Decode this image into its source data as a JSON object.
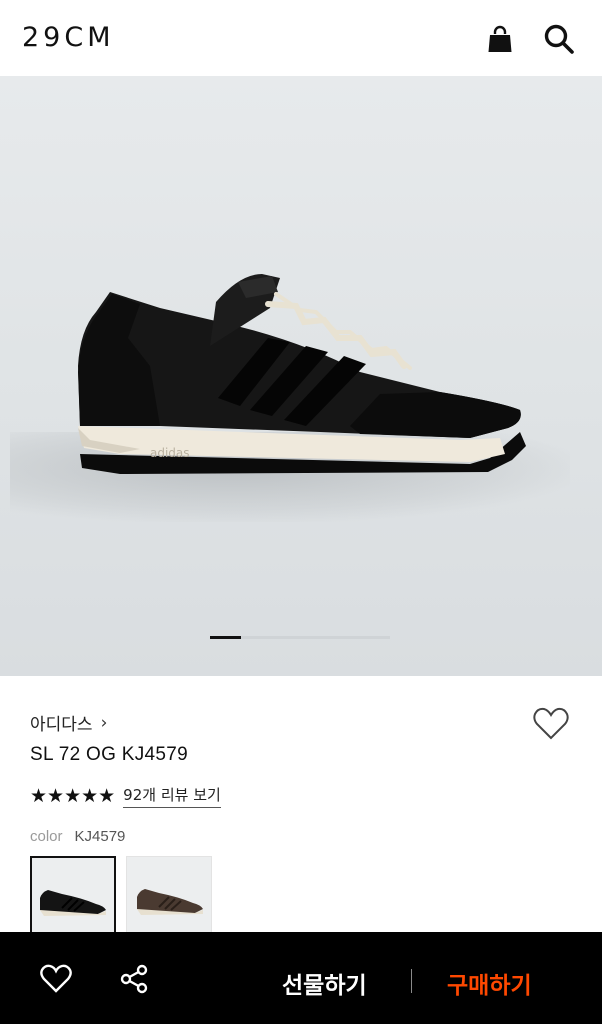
{
  "header": {
    "logo": "29CM",
    "bag_icon": "shopping-bag-icon",
    "search_icon": "search-icon"
  },
  "gallery": {
    "image_alt": "adidas",
    "pager_total": 6,
    "pager_current": 1
  },
  "product": {
    "brand": "아디다스",
    "brand_chevron": "›",
    "name": "SL 72 OG KJ4579",
    "rating_stars": 5,
    "stars": "★★★★★",
    "review_link": "92개 리뷰 보기",
    "color_label": "color",
    "color_value": "KJ4579",
    "swatches": [
      {
        "name": "black",
        "selected": true
      },
      {
        "name": "brown",
        "selected": false
      }
    ]
  },
  "bottom_bar": {
    "wishlist_icon": "heart-icon",
    "share_icon": "share-icon",
    "gift_label": "선물하기",
    "buy_label": "구매하기",
    "buy_color": "#ff4800"
  }
}
